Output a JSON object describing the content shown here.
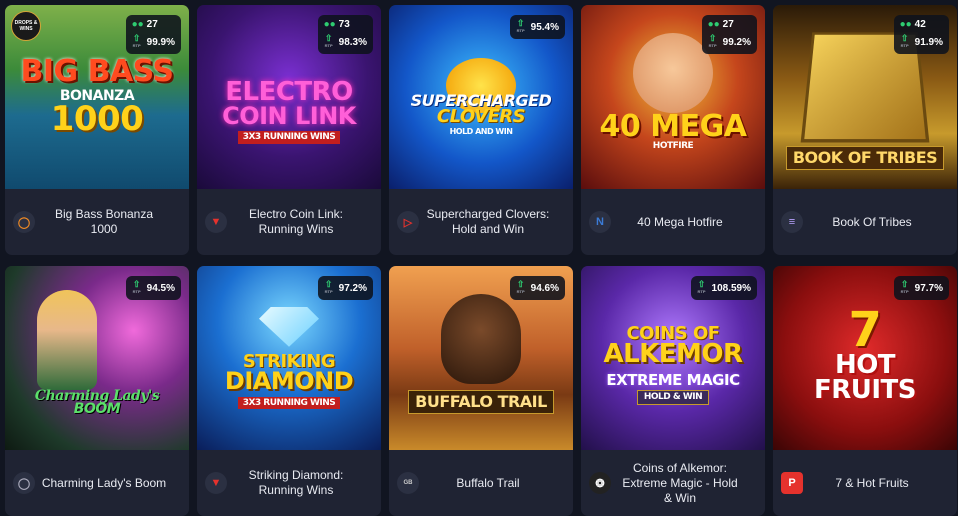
{
  "colors": {
    "background": "#111521",
    "card": "#1f2333",
    "accent_green": "#2ecc71"
  },
  "badge_drops": "DROPS & WINS",
  "games": [
    {
      "name": "Big Bass Bonanza 1000",
      "art_lines": [
        "BIG BASS",
        "BONANZA",
        "1000"
      ],
      "players": "27",
      "rtp": "99.9%",
      "provider_icon": "pragmatic-icon"
    },
    {
      "name": "Electro Coin Link: Running Wins",
      "art_lines": [
        "ELECTRO",
        "COIN LINK",
        "3X3 RUNNING WINS"
      ],
      "players": "73",
      "rtp": "98.3%",
      "provider_icon": "fugaso-icon"
    },
    {
      "name": "Supercharged Clovers: Hold and Win",
      "art_lines": [
        "SUPERCHARGED",
        "CLOVERS",
        "HOLD AND WIN"
      ],
      "players": "",
      "rtp": "95.4%",
      "provider_icon": "playson-icon"
    },
    {
      "name": "40 Mega Hotfire",
      "art_lines": [
        "40 MEGA",
        "HOTFIRE"
      ],
      "players": "27",
      "rtp": "99.2%",
      "provider_icon": "netgame-icon"
    },
    {
      "name": "Book Of Tribes",
      "art_lines": [
        "BOOK OF TRIBES"
      ],
      "players": "42",
      "rtp": "91.9%",
      "provider_icon": "endorphina-icon"
    },
    {
      "name": "Charming Lady's Boom",
      "art_lines": [
        "Charming Lady's",
        "BOOM"
      ],
      "players": "",
      "rtp": "94.5%",
      "provider_icon": "gamomat-icon"
    },
    {
      "name": "Striking Diamond: Running Wins",
      "art_lines": [
        "STRIKING",
        "DIAMOND",
        "3X3 RUNNING WINS"
      ],
      "players": "",
      "rtp": "97.2%",
      "provider_icon": "fugaso-icon"
    },
    {
      "name": "Buffalo Trail",
      "art_lines": [
        "BUFFALO TRAIL"
      ],
      "players": "",
      "rtp": "94.6%",
      "provider_icon": "gamebeat-icon"
    },
    {
      "name": "Coins of Alkemor: Extreme Magic - Hold & Win",
      "art_lines": [
        "COINS OF",
        "ALKEMOR",
        "EXTREME MAGIC",
        "HOLD & WIN"
      ],
      "players": "",
      "rtp": "108.59%",
      "provider_icon": "booongo-icon"
    },
    {
      "name": "7 & Hot Fruits",
      "art_lines": [
        "7",
        "HOT",
        "FRUITS"
      ],
      "players": "",
      "rtp": "97.7%",
      "provider_icon": "playson-p-icon"
    }
  ]
}
